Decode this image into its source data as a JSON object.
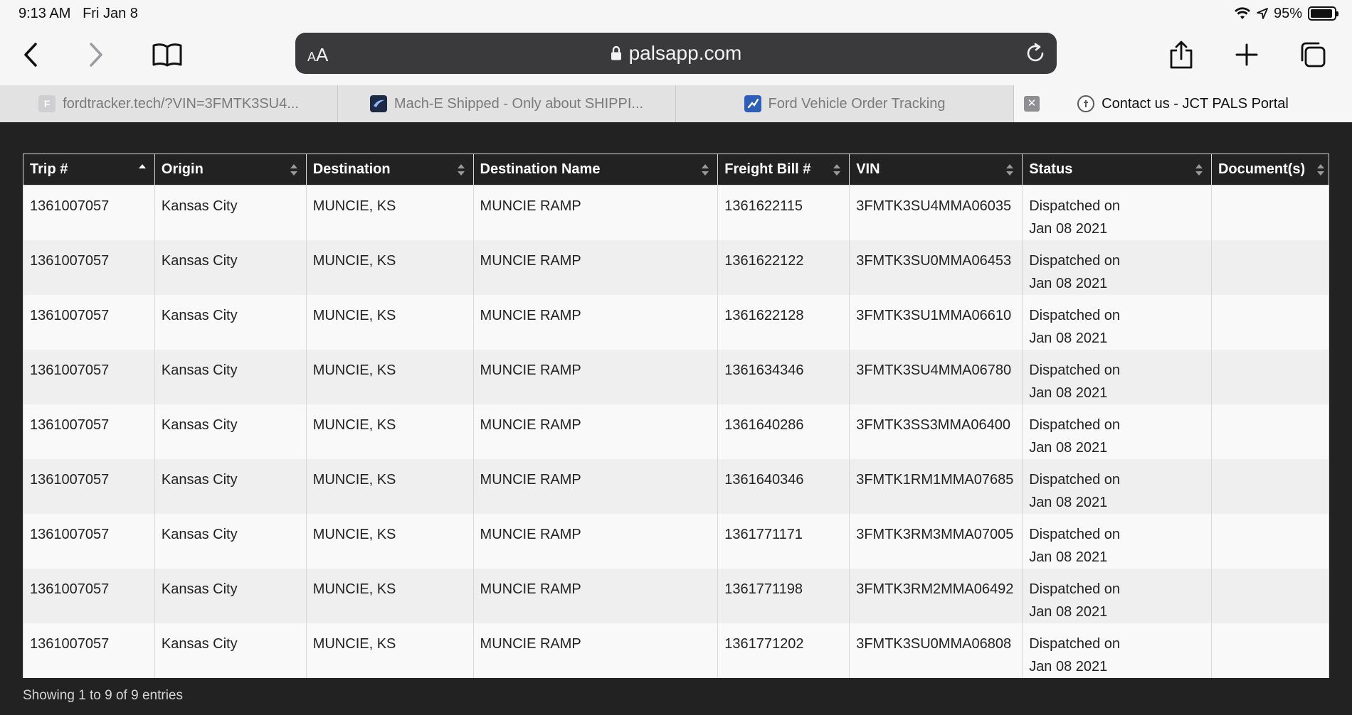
{
  "status_bar": {
    "time": "9:13 AM",
    "date": "Fri Jan 8",
    "battery_percent": "95%",
    "battery_level": 0.95
  },
  "toolbar": {
    "aa_label_small": "A",
    "aa_label_large": "A",
    "url": "palsapp.com",
    "icons": [
      "back-icon",
      "forward-icon",
      "bookmarks-icon",
      "lock-icon",
      "reload-icon",
      "share-icon",
      "new-tab-icon",
      "tabs-icon"
    ]
  },
  "tabs": [
    {
      "title": "fordtracker.tech/?VIN=3FMTK3SU4...",
      "favicon_letter": "F",
      "favicon_color": "#cfcfd2"
    },
    {
      "title": "Mach-E Shipped - Only about SHIPPI...",
      "favicon_letter": "",
      "favicon_color": "#1c2a44"
    },
    {
      "title": "Ford Vehicle Order Tracking",
      "favicon_letter": "",
      "favicon_color": "#2d5fb8"
    },
    {
      "title": "Contact us - JCT PALS Portal",
      "favicon_letter": "",
      "favicon_color": "#5a5a5a",
      "active": true
    }
  ],
  "table": {
    "columns": [
      "Trip #",
      "Origin",
      "Destination",
      "Destination Name",
      "Freight Bill #",
      "VIN",
      "Status",
      "Document(s)"
    ],
    "rows": [
      {
        "trip": "1361007057",
        "origin": "Kansas City",
        "destination": "MUNCIE, KS",
        "destination_name": "MUNCIE RAMP",
        "freight_bill": "1361622115",
        "vin": "3FMTK3SU4MMA06035",
        "status_line1": "Dispatched on",
        "status_line2": "Jan 08 2021",
        "documents": ""
      },
      {
        "trip": "1361007057",
        "origin": "Kansas City",
        "destination": "MUNCIE, KS",
        "destination_name": "MUNCIE RAMP",
        "freight_bill": "1361622122",
        "vin": "3FMTK3SU0MMA06453",
        "status_line1": "Dispatched on",
        "status_line2": "Jan 08 2021",
        "documents": ""
      },
      {
        "trip": "1361007057",
        "origin": "Kansas City",
        "destination": "MUNCIE, KS",
        "destination_name": "MUNCIE RAMP",
        "freight_bill": "1361622128",
        "vin": "3FMTK3SU1MMA06610",
        "status_line1": "Dispatched on",
        "status_line2": "Jan 08 2021",
        "documents": ""
      },
      {
        "trip": "1361007057",
        "origin": "Kansas City",
        "destination": "MUNCIE, KS",
        "destination_name": "MUNCIE RAMP",
        "freight_bill": "1361634346",
        "vin": "3FMTK3SU4MMA06780",
        "status_line1": "Dispatched on",
        "status_line2": "Jan 08 2021",
        "documents": ""
      },
      {
        "trip": "1361007057",
        "origin": "Kansas City",
        "destination": "MUNCIE, KS",
        "destination_name": "MUNCIE RAMP",
        "freight_bill": "1361640286",
        "vin": "3FMTK3SS3MMA06400",
        "status_line1": "Dispatched on",
        "status_line2": "Jan 08 2021",
        "documents": ""
      },
      {
        "trip": "1361007057",
        "origin": "Kansas City",
        "destination": "MUNCIE, KS",
        "destination_name": "MUNCIE RAMP",
        "freight_bill": "1361640346",
        "vin": "3FMTK1RM1MMA07685",
        "status_line1": "Dispatched on",
        "status_line2": "Jan 08 2021",
        "documents": ""
      },
      {
        "trip": "1361007057",
        "origin": "Kansas City",
        "destination": "MUNCIE, KS",
        "destination_name": "MUNCIE RAMP",
        "freight_bill": "1361771171",
        "vin": "3FMTK3RM3MMA07005",
        "status_line1": "Dispatched on",
        "status_line2": "Jan 08 2021",
        "documents": ""
      },
      {
        "trip": "1361007057",
        "origin": "Kansas City",
        "destination": "MUNCIE, KS",
        "destination_name": "MUNCIE RAMP",
        "freight_bill": "1361771198",
        "vin": "3FMTK3RM2MMA06492",
        "status_line1": "Dispatched on",
        "status_line2": "Jan 08 2021",
        "documents": ""
      },
      {
        "trip": "1361007057",
        "origin": "Kansas City",
        "destination": "MUNCIE, KS",
        "destination_name": "MUNCIE RAMP",
        "freight_bill": "1361771202",
        "vin": "3FMTK3SU0MMA06808",
        "status_line1": "Dispatched on",
        "status_line2": "Jan 08 2021",
        "documents": ""
      }
    ],
    "info": "Showing 1 to 9 of 9 entries"
  },
  "colors": {
    "page_bg": "#222222",
    "header_bg": "#222222",
    "row_odd": "#f9f9f9",
    "row_even": "#efefef",
    "url_bar": "#3a3a3c"
  }
}
